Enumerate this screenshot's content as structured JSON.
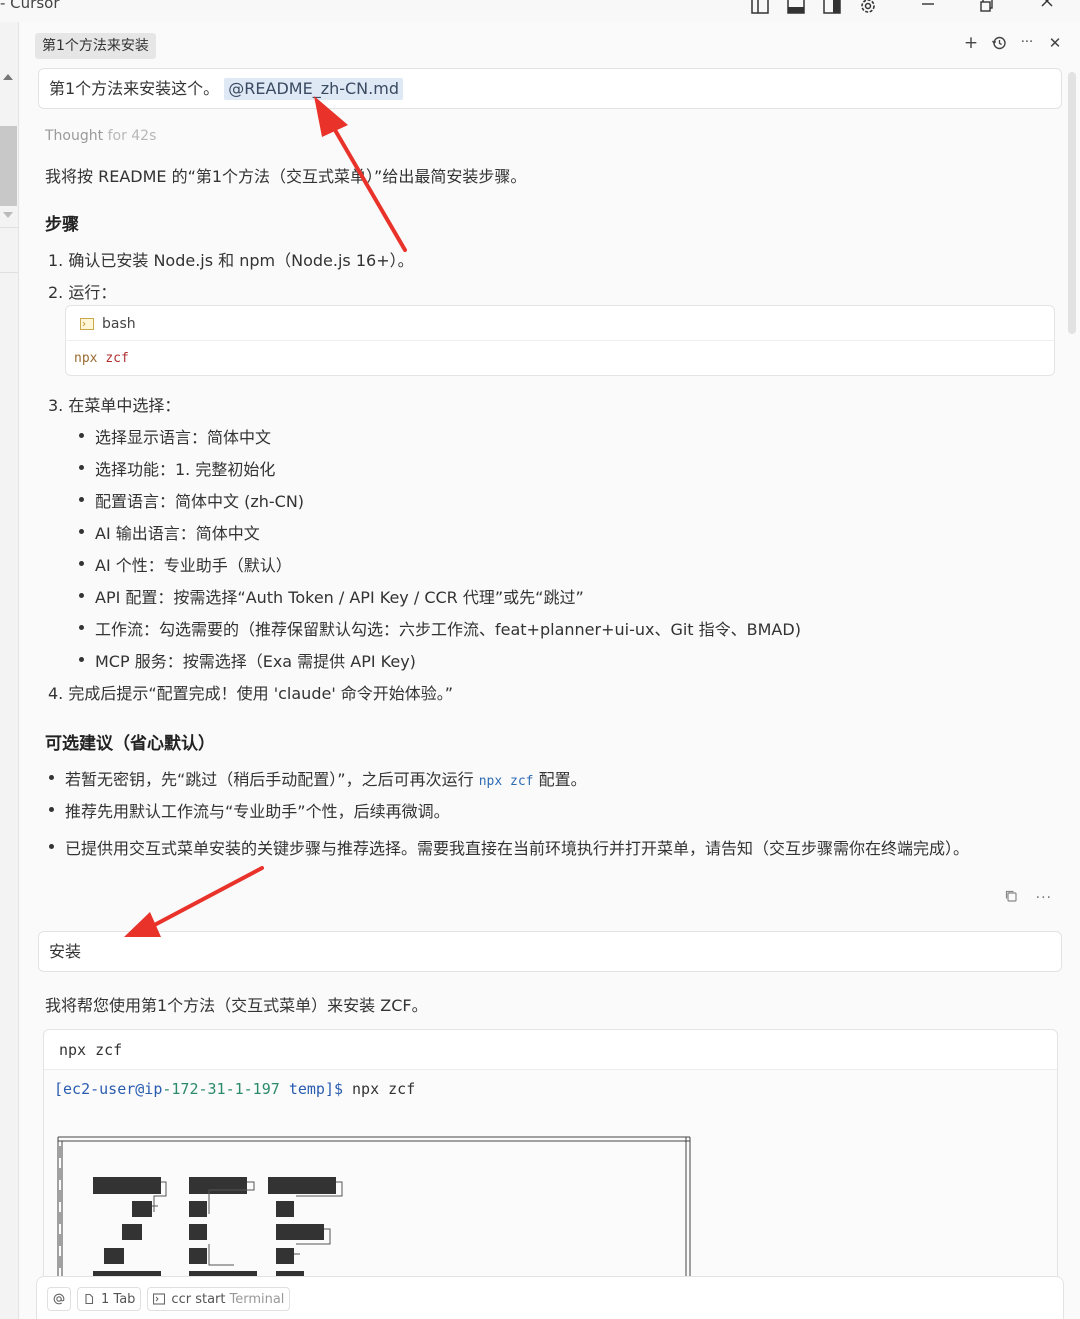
{
  "window": {
    "title": "- Cursor"
  },
  "tab": {
    "label": "第1个方法来安装"
  },
  "tab_actions": {
    "new": "+",
    "more": "···",
    "close": "✕"
  },
  "messages": {
    "first": {
      "text": "第1个方法来安装这个。",
      "mention": "@README_zh-CN.md"
    },
    "thought": {
      "label": "Thought",
      "duration": "for 42s"
    },
    "intro": "我将按 README 的“第1个方法（交互式菜单）”给出最简安装步骤。",
    "steps_heading": "步骤",
    "steps": [
      "1. 确认已安装 Node.js 和 npm（Node.js 16+）。",
      "2. 运行：",
      "3. 在菜单中选择：",
      "4. 完成后提示“配置完成！使用 'claude' 命令开始体验。”"
    ],
    "code": {
      "lang": "bash",
      "cmd": "npx",
      "arg": "zcf"
    },
    "menu_choices": [
      "选择显示语言：简体中文",
      "选择功能：1. 完整初始化",
      "配置语言：简体中文 (zh-CN)",
      "AI 输出语言：简体中文",
      "AI 个性：专业助手（默认）",
      "API 配置：按需选择“Auth Token / API Key / CCR 代理”或先“跳过”",
      "工作流：勾选需要的（推荐保留默认勾选：六步工作流、feat+planner+ui-ux、Git 指令、BMAD)",
      "MCP 服务：按需选择（Exa 需提供 API Key)"
    ],
    "optional_heading": "可选建议（省心默认）",
    "optional": {
      "item1_before": "若暂无密钥，先“跳过（稍后手动配置）”，之后可再次运行",
      "item1_code": "npx zcf",
      "item1_after": "配置。",
      "item2": "推荐先用默认工作流与“专业助手”个性，后续再微调。"
    },
    "summary": "已提供用交互式菜单安装的关键步骤与推荐选择。需要我直接在当前环境执行并打开菜单，请告知（交互步骤需你在终端完成）。",
    "second": {
      "text": "安装"
    },
    "reply": "我将帮您使用第1个方法（交互式菜单）来安装 ZCF。",
    "terminal": {
      "command": "npx zcf",
      "prompt_open": "[",
      "prompt_user": "ec2-user@ip",
      "prompt_host": "-172-31-1-197",
      "prompt_dir": "temp",
      "prompt_close": "]$",
      "prompt_cmd": "npx zcf"
    }
  },
  "composer": {
    "mention_icon": "at-icon",
    "tab_chip": "1 Tab",
    "terminal_chip": "ccr start",
    "terminal_chip_suffix": "Terminal"
  },
  "colors": {
    "arrow": "#e8322a",
    "mention_bg": "#dfe8f5",
    "link": "#2d6bb4"
  }
}
